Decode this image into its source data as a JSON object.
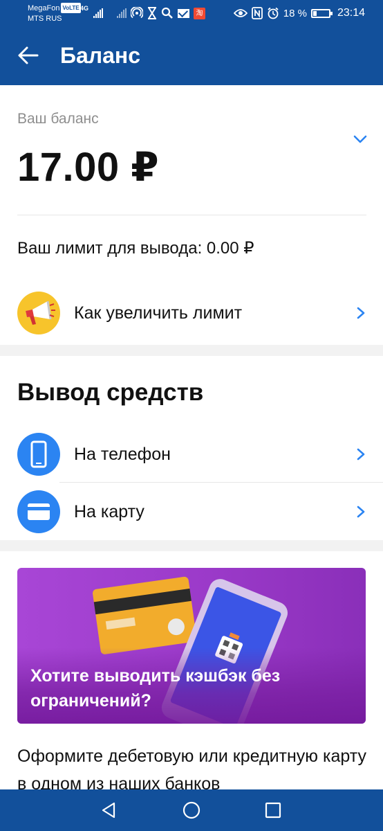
{
  "status_bar": {
    "carrier1": "MegaFon",
    "volte": "VoLTE",
    "network_type": "4G",
    "carrier2": "MTS RUS",
    "shop_badge": "淘",
    "battery": "18 %",
    "time": "23:14",
    "icons": [
      "signal-icon",
      "hotspot-icon",
      "hourglass-icon",
      "search-icon",
      "mail-icon",
      "shop-icon",
      "eye-icon",
      "nfc-icon",
      "alarm-icon",
      "battery-icon"
    ]
  },
  "app_bar": {
    "title": "Баланс",
    "back_icon": "arrow-left-icon"
  },
  "balance": {
    "label": "Ваш баланс",
    "value": "17.00 ₽",
    "expand_icon": "chevron-down-icon",
    "limit_text": "Ваш лимит для вывода: 0.00 ₽"
  },
  "increase_limit": {
    "label": "Как увеличить лимит",
    "icon": "megaphone-icon"
  },
  "withdraw": {
    "title": "Вывод средств",
    "options": [
      {
        "label": "На телефон",
        "icon": "phone-icon"
      },
      {
        "label": "На карту",
        "icon": "card-icon"
      }
    ]
  },
  "promo": {
    "title": "Хотите выводить кэшбэк без ограничений?"
  },
  "description": "Оформите дебетовую или кредитную карту в одном из наших банков",
  "colors": {
    "brand": "#12509b",
    "accent_blue": "#2b84f2",
    "promo_purple": "#a846d6",
    "megaphone_yellow": "#f7c42b"
  }
}
